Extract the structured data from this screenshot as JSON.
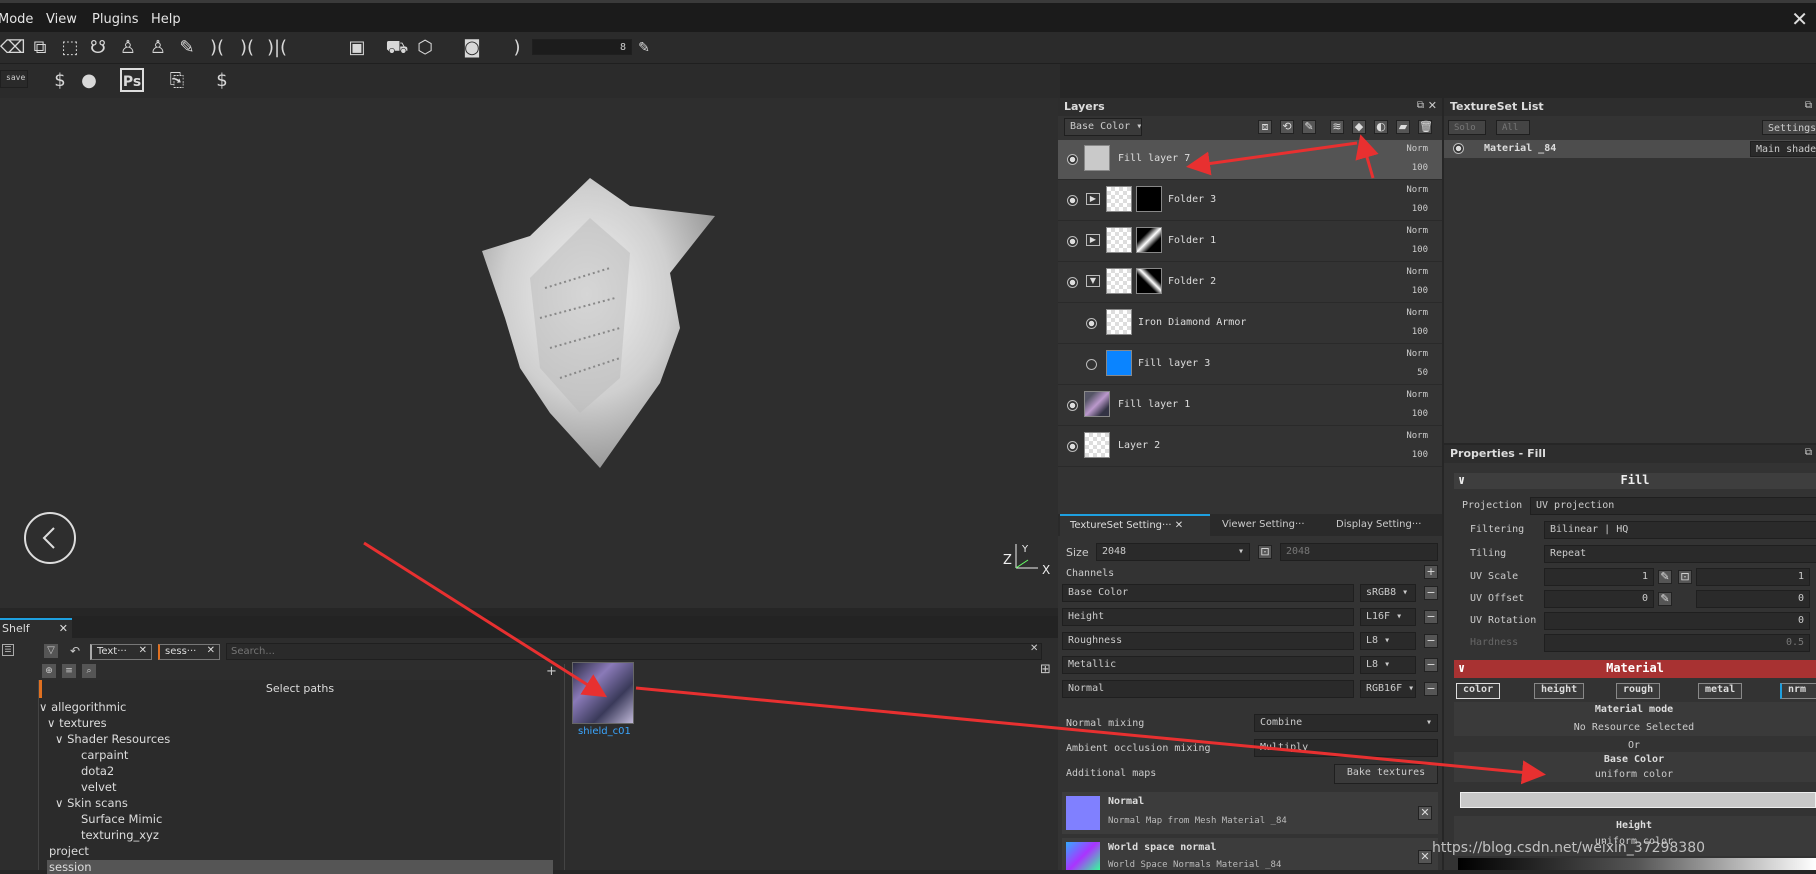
{
  "menu": {
    "mode": "Mode",
    "view": "View",
    "plugins": "Plugins",
    "help": "Help"
  },
  "toolbar": {
    "brush_size": "8",
    "save_label": "save"
  },
  "layers": {
    "title": "Layers",
    "channel": "Base Color",
    "items": [
      {
        "name": "Fill layer 7",
        "blend": "Norm",
        "opacity": "100"
      },
      {
        "name": "Folder 3",
        "blend": "Norm",
        "opacity": "100"
      },
      {
        "name": "Folder 1",
        "blend": "Norm",
        "opacity": "100"
      },
      {
        "name": "Folder 2",
        "blend": "Norm",
        "opacity": "100"
      },
      {
        "name": "Iron Diamond Armor",
        "blend": "Norm",
        "opacity": "100"
      },
      {
        "name": "Fill layer 3",
        "blend": "Norm",
        "opacity": "50"
      },
      {
        "name": "Fill layer 1",
        "blend": "Norm",
        "opacity": "100"
      },
      {
        "name": "Layer 2",
        "blend": "Norm",
        "opacity": "100"
      }
    ]
  },
  "textureset_list": {
    "title": "TextureSet List",
    "solo": "Solo",
    "all": "All",
    "settings": "Settings",
    "material": "Material _84",
    "shader": "Main shade"
  },
  "tabs": {
    "tss": "TextureSet Setting···",
    "viewer": "Viewer Setting···",
    "display": "Display Setting···"
  },
  "tss": {
    "size_label": "Size",
    "size": "2048",
    "size2": "2048",
    "channels_label": "Channels",
    "channels": [
      {
        "name": "Base Color",
        "format": "sRGB8"
      },
      {
        "name": "Height",
        "format": "L16F"
      },
      {
        "name": "Roughness",
        "format": "L8"
      },
      {
        "name": "Metallic",
        "format": "L8"
      },
      {
        "name": "Normal",
        "format": "RGB16F"
      }
    ],
    "normal_mixing_label": "Normal mixing",
    "normal_mixing": "Combine",
    "ao_mixing_label": "Ambient occlusion mixing",
    "ao_mixing": "Multiply",
    "additional_maps": "Additional maps",
    "bake": "Bake textures",
    "maps": [
      {
        "title": "Normal",
        "desc": "Normal Map from Mesh Material _84"
      },
      {
        "title": "World space normal",
        "desc": "World Space Normals Material _84"
      }
    ]
  },
  "props": {
    "title": "Properties - Fill",
    "fill": "Fill",
    "projection_label": "Projection",
    "projection": "UV projection",
    "filtering_label": "Filtering",
    "filtering": "Bilinear | HQ",
    "tiling_label": "Tiling",
    "tiling": "Repeat",
    "uvscale_label": "UV Scale",
    "uvscale": "1",
    "uvscale2": "1",
    "uvoffset_label": "UV Offset",
    "uvoffset": "0",
    "uvoffset2": "0",
    "uvrot_label": "UV Rotation",
    "uvrot": "0",
    "hardness_label": "Hardness",
    "hardness": "0.5",
    "material": "Material",
    "mattabs": [
      "color",
      "height",
      "rough",
      "metal",
      "nrm"
    ],
    "material_mode": "Material mode",
    "no_resource": "No Resource Selected",
    "or": "Or",
    "base_color": "Base Color",
    "uniform_color": "uniform color",
    "height": "Height",
    "height_uniform": "uniform color"
  },
  "shelf": {
    "title": "Shelf",
    "chip1": "Text···",
    "chip2": "sess···",
    "search_placeholder": "Search...",
    "select_paths": "Select paths",
    "tree": [
      "allegorithmic",
      "textures",
      "Shader Resources",
      "carpaint",
      "dota2",
      "velvet",
      "Skin scans",
      "Surface Mimic",
      "texturing_xyz",
      "project",
      "session"
    ],
    "asset": "shield_c01"
  },
  "gizmo": {
    "z": "Z",
    "y": "Y",
    "x": "X"
  },
  "watermark": "https://blog.csdn.net/weixin_37298380",
  "colors": {
    "accent": "#1ea0e0",
    "material_header": "#a83232",
    "arrow": "#e83030",
    "selected": "#545454"
  }
}
